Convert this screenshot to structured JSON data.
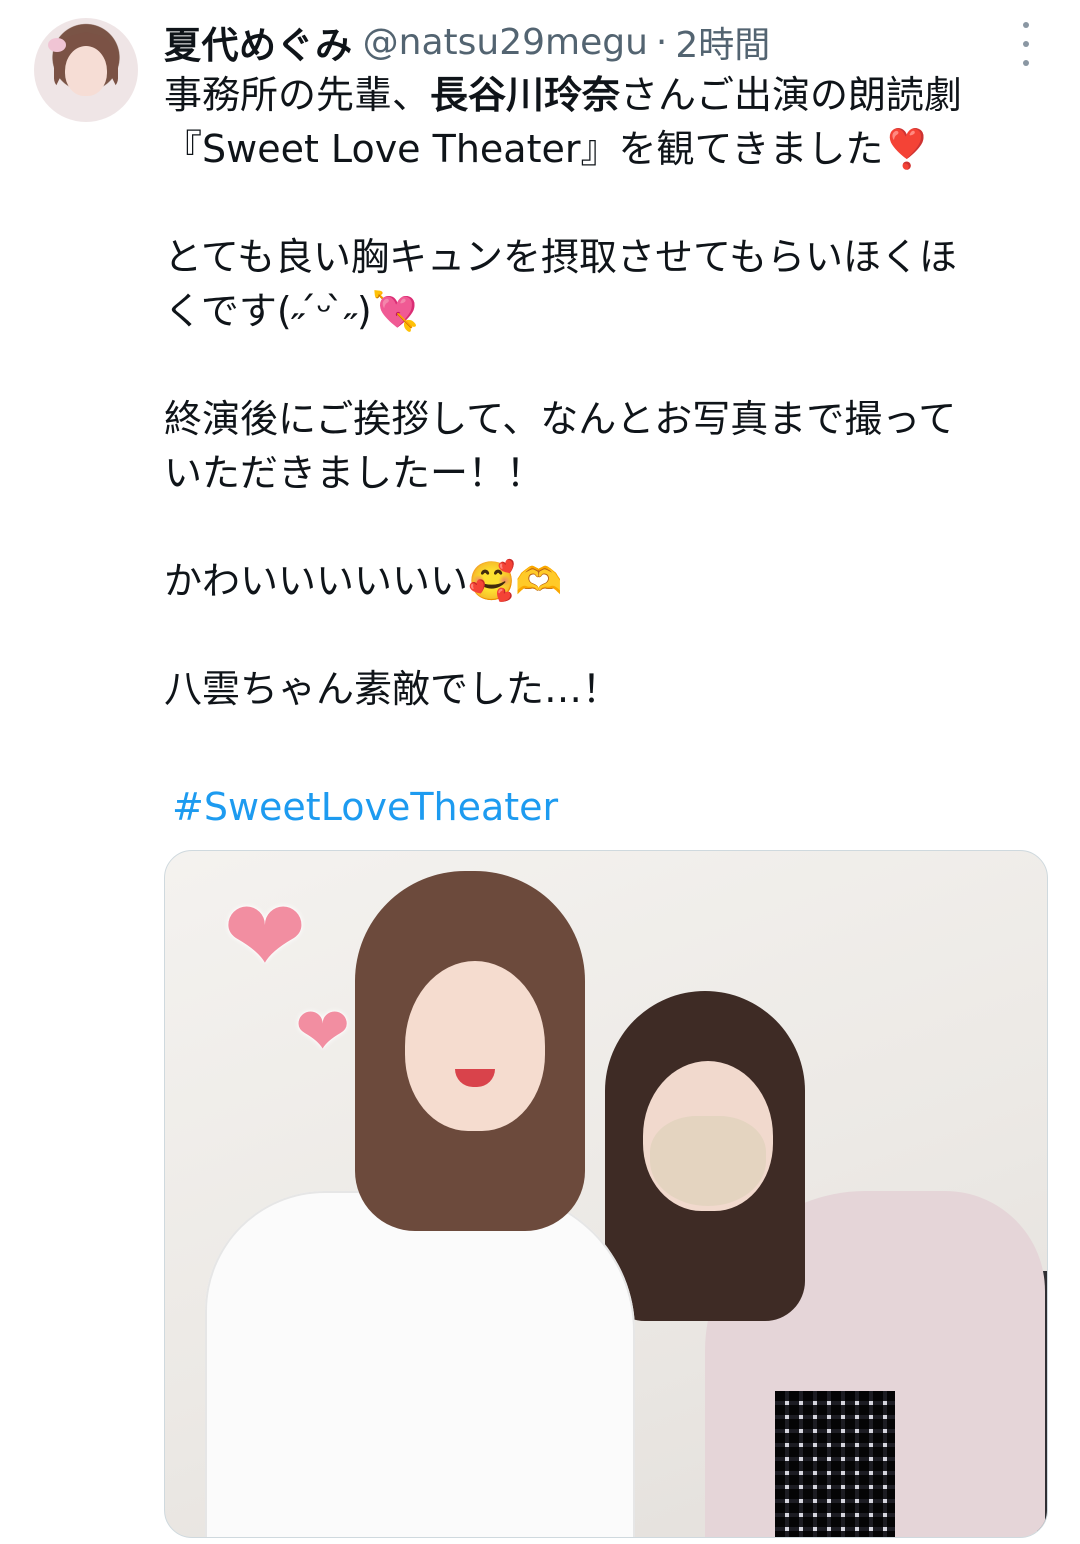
{
  "user": {
    "display_name": "夏代めぐみ",
    "handle": "@natsu29megu",
    "separator": "·",
    "timestamp": "2時間"
  },
  "icons": {
    "more": "more-vertical-icon",
    "avatar": "avatar"
  },
  "tweet": {
    "line1_pre": "事務所の先輩、",
    "line1_bold": "長谷川玲奈",
    "line1_post": "さんご出演の朗読劇",
    "line2": "『Sweet Love Theater』を観てきました❣️",
    "line3": "とても良い胸キュンを摂取させてもらいほくほ",
    "line4": "くです(˶ ́ᵕ ̀˶)💘",
    "line5": "終演後にご挨拶して、なんとお写真まで撮って",
    "line6": "いただきましたー！！",
    "line7": "かわいいいいいい🥰🫶",
    "line8": "八雲ちゃん素敵でした…！",
    "hashtag": "#SweetLoveTheater"
  },
  "media": {
    "heart_big": "❤",
    "heart_small": "❤"
  },
  "colors": {
    "text": "#0f1419",
    "secondary": "#536471",
    "link": "#1d9bf0",
    "border": "#cfd9de"
  }
}
